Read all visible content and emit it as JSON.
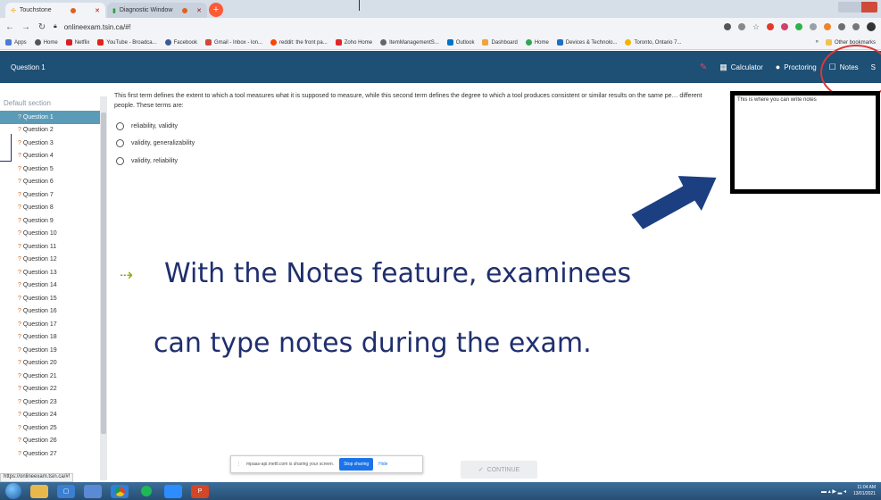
{
  "browser": {
    "tabs": [
      {
        "title": "Touchstone",
        "active": true
      },
      {
        "title": "Diagnostic Window",
        "active": false
      }
    ],
    "url": "onlineexam.tsin.ca/#!",
    "bookmarks": [
      "Apps",
      "Home",
      "Netflix",
      "YouTube - Broadca...",
      "Facebook",
      "Gmail - Inbox - lon...",
      "reddit: the front pa...",
      "Zoho Home",
      "ItemManagementS...",
      "Outlook",
      "Dashboard",
      "Home",
      "Devices & Technolo...",
      "Toronto, Ontario 7..."
    ],
    "bookmarks_more": "»",
    "other_bookmarks": "Other bookmarks",
    "status_url": "https://onlineexam.tsin.ca/#!"
  },
  "header": {
    "question_title": "Question 1",
    "calculator_label": "Calculator",
    "proctoring_label": "Proctoring",
    "notes_label": "Notes",
    "extra": "S"
  },
  "sidebar": {
    "section_title": "Default section",
    "questions": [
      "Question 1",
      "Question 2",
      "Question 3",
      "Question 4",
      "Question 5",
      "Question 6",
      "Question 7",
      "Question 8",
      "Question 9",
      "Question 10",
      "Question 11",
      "Question 12",
      "Question 13",
      "Question 14",
      "Question 15",
      "Question 16",
      "Question 17",
      "Question 18",
      "Question 19",
      "Question 20",
      "Question 21",
      "Question 22",
      "Question 23",
      "Question 24",
      "Question 25",
      "Question 26",
      "Question 27"
    ],
    "mark": "?"
  },
  "question": {
    "text": "This first term defines the extent to which a tool measures what it is supposed to measure, while this second term defines the degree to which a tool produces consistent or similar results on the same pe… different people. These terms are:",
    "options": [
      "reliability, validity",
      "validity, generalizability",
      "validity, reliability"
    ]
  },
  "notes": {
    "placeholder": "This is where you can write notes"
  },
  "caption": {
    "line1": "With the Notes feature, examinees",
    "line2": "can type notes during the exam."
  },
  "sharing": {
    "message": "mpaas-api.mettl.com is sharing your screen.",
    "stop_label": "Stop sharing",
    "hide_label": "Hide"
  },
  "continue_label": "CONTINUE",
  "taskbar": {
    "time": "11:04 AM",
    "date": "13/01/2021"
  },
  "colors": {
    "header_bg": "#1e4f74",
    "active_question": "#5a9bb8",
    "caption_text": "#1f2f6e",
    "arrow": "#1c3f82",
    "highlight_circle": "#d63a3a"
  }
}
